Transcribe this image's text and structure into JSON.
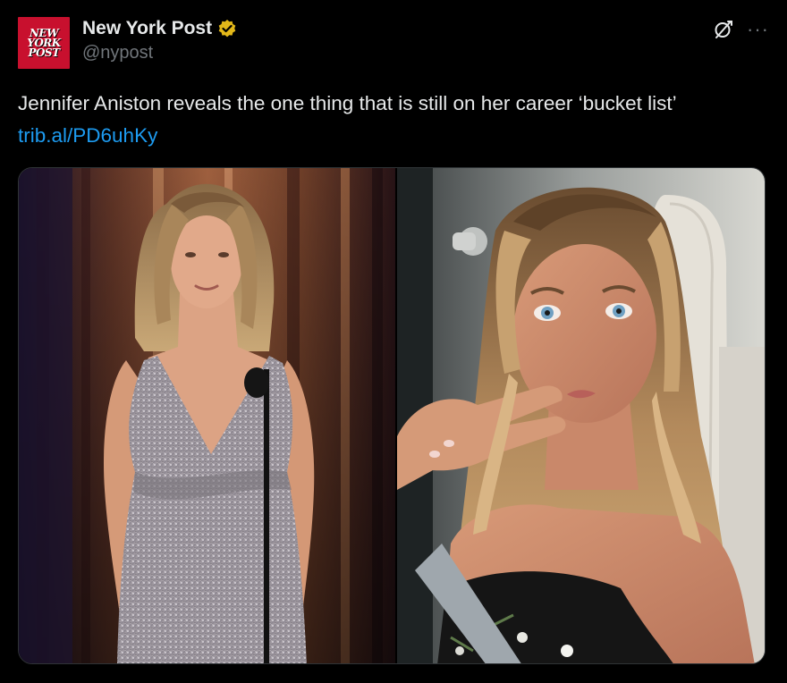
{
  "account": {
    "avatar_logo_lines": [
      "NEW",
      "YORK",
      "POST"
    ],
    "display_name": "New York Post",
    "handle": "@nypost",
    "verified_badge": "gold-check-badge-icon"
  },
  "header_actions": {
    "grok_icon": "grok-icon",
    "more_icon": "more-dots-icon",
    "more_glyph": "···"
  },
  "tweet": {
    "text": "Jennifer Aniston reveals the one thing that is still on her career ‘bucket list’ ",
    "link": "trib.al/PD6uhKy"
  },
  "colors": {
    "background": "#000000",
    "text": "#e7e9ea",
    "muted": "#71767b",
    "link": "#1d9bf0",
    "brand_red": "#c8102e",
    "verified_gold": "#e2b719"
  },
  "media": {
    "count": 2
  }
}
